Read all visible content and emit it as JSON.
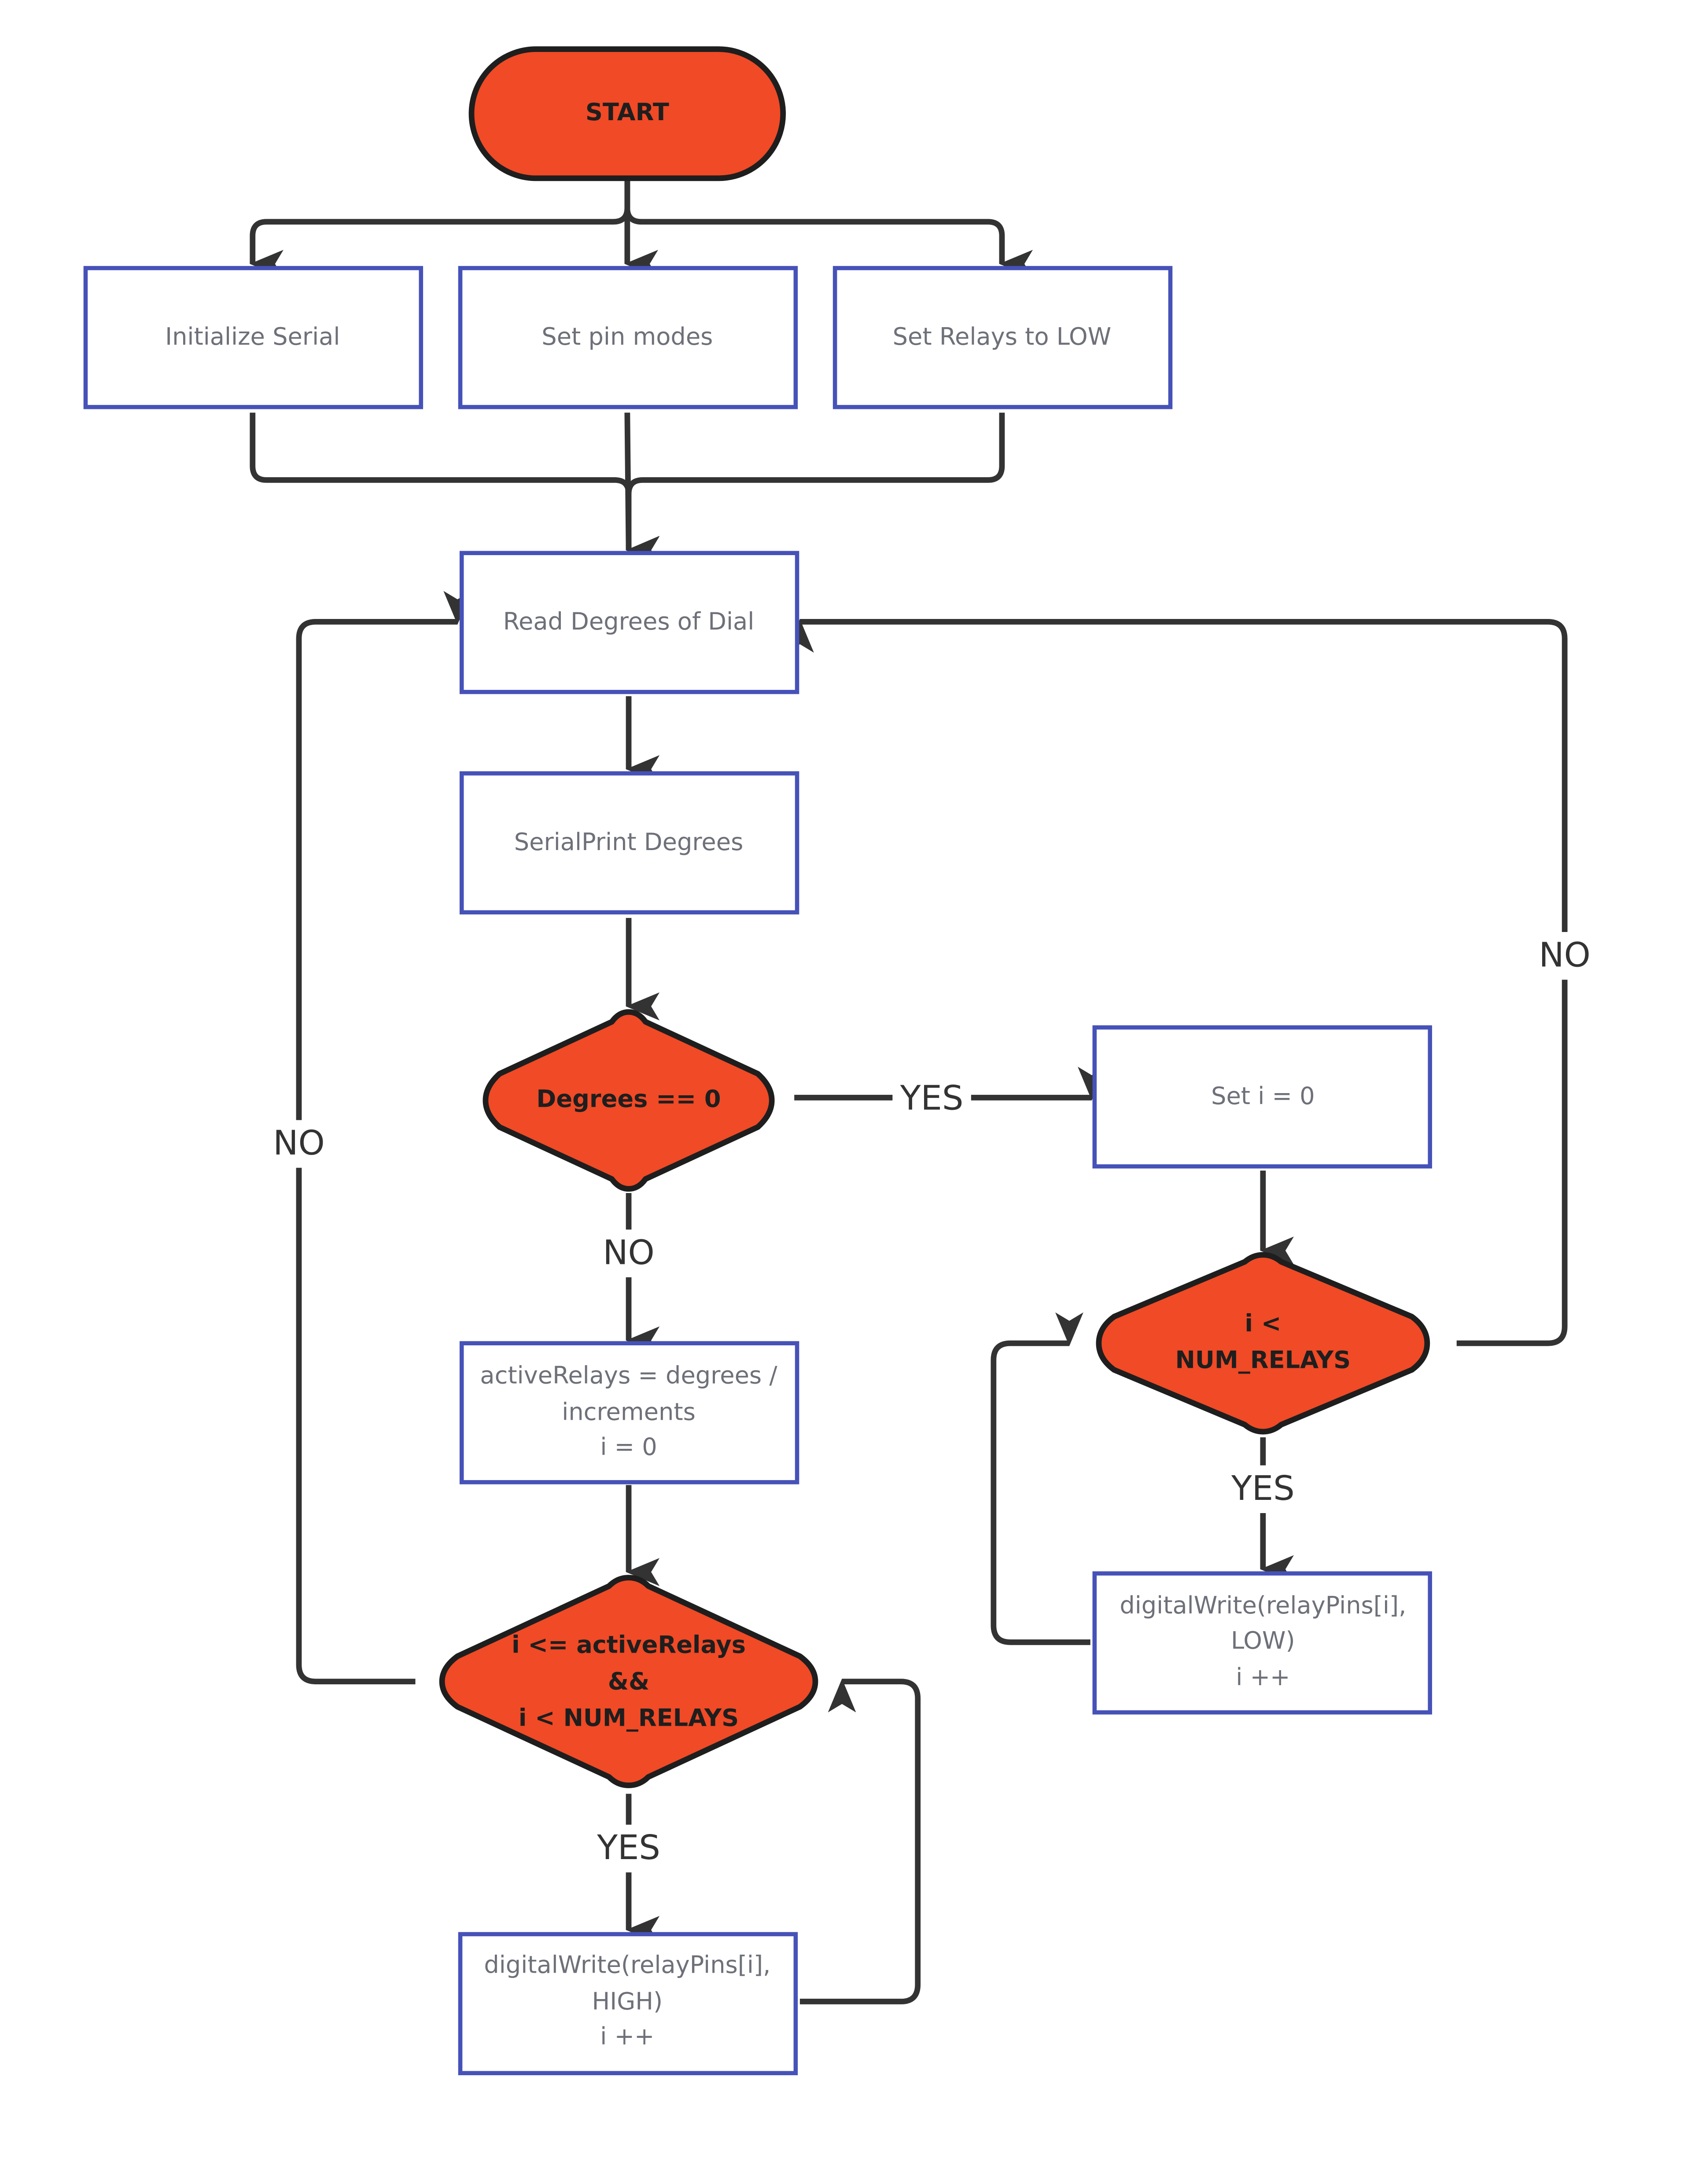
{
  "diagram": {
    "type": "flowchart",
    "colors": {
      "terminal_fill": "#f04a26",
      "decision_fill": "#f04a26",
      "process_border": "#4652b8",
      "edge": "#333333",
      "process_text": "#6e7079",
      "decision_text": "#1e1e1e"
    },
    "nodes": {
      "start": {
        "shape": "terminal",
        "lines": [
          "START"
        ]
      },
      "init_serial": {
        "shape": "process",
        "lines": [
          "Initialize Serial"
        ]
      },
      "set_pin_modes": {
        "shape": "process",
        "lines": [
          "Set pin modes"
        ]
      },
      "set_relays_low": {
        "shape": "process",
        "lines": [
          "Set Relays to LOW"
        ]
      },
      "read_degrees": {
        "shape": "process",
        "lines": [
          "Read Degrees of Dial"
        ]
      },
      "serial_print": {
        "shape": "process",
        "lines": [
          "SerialPrint Degrees"
        ]
      },
      "degrees_zero": {
        "shape": "decision",
        "lines": [
          "Degrees == 0"
        ]
      },
      "active_relays": {
        "shape": "process",
        "lines": [
          "activeRelays = degrees /",
          "increments",
          "i = 0"
        ]
      },
      "loop_cond": {
        "shape": "decision",
        "lines": [
          "i <= activeRelays",
          "&&",
          "i < NUM_RELAYS"
        ]
      },
      "write_high": {
        "shape": "process",
        "lines": [
          "digitalWrite(relayPins[i],",
          "HIGH)",
          "i ++"
        ]
      },
      "set_i_zero": {
        "shape": "process",
        "lines": [
          "Set i = 0"
        ]
      },
      "off_cond": {
        "shape": "decision",
        "lines": [
          "i <",
          "NUM_RELAYS"
        ]
      },
      "write_low": {
        "shape": "process",
        "lines": [
          "digitalWrite(relayPins[i],",
          "LOW)",
          "i ++"
        ]
      }
    },
    "edges": [
      {
        "from": "start",
        "to": "init_serial",
        "label": ""
      },
      {
        "from": "start",
        "to": "set_pin_modes",
        "label": ""
      },
      {
        "from": "start",
        "to": "set_relays_low",
        "label": ""
      },
      {
        "from": "init_serial",
        "to": "read_degrees",
        "label": ""
      },
      {
        "from": "set_pin_modes",
        "to": "read_degrees",
        "label": ""
      },
      {
        "from": "set_relays_low",
        "to": "read_degrees",
        "label": ""
      },
      {
        "from": "read_degrees",
        "to": "serial_print",
        "label": ""
      },
      {
        "from": "serial_print",
        "to": "degrees_zero",
        "label": ""
      },
      {
        "from": "degrees_zero",
        "to": "set_i_zero",
        "label": "YES"
      },
      {
        "from": "degrees_zero",
        "to": "active_relays",
        "label": "NO"
      },
      {
        "from": "active_relays",
        "to": "loop_cond",
        "label": ""
      },
      {
        "from": "loop_cond",
        "to": "write_high",
        "label": "YES"
      },
      {
        "from": "write_high",
        "to": "loop_cond",
        "label": ""
      },
      {
        "from": "loop_cond",
        "to": "read_degrees",
        "label": "NO"
      },
      {
        "from": "set_i_zero",
        "to": "off_cond",
        "label": ""
      },
      {
        "from": "off_cond",
        "to": "write_low",
        "label": "YES"
      },
      {
        "from": "write_low",
        "to": "off_cond",
        "label": ""
      },
      {
        "from": "off_cond",
        "to": "read_degrees",
        "label": "NO"
      }
    ],
    "labels": {
      "yes": "YES",
      "no": "NO"
    }
  }
}
